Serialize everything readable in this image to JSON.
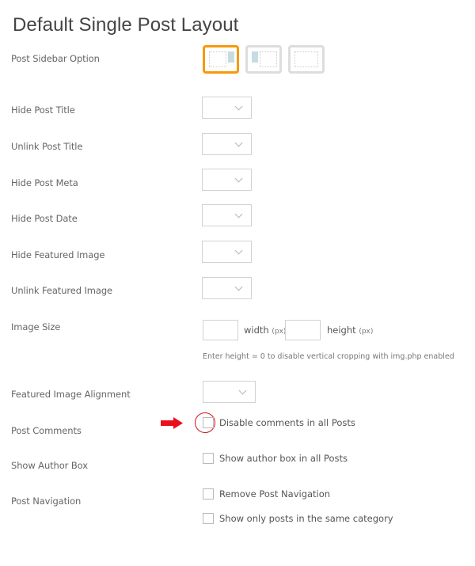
{
  "page": {
    "title": "Default Single Post Layout"
  },
  "sidebar_option": {
    "label": "Post Sidebar Option",
    "options": [
      {
        "name": "sidebar-right",
        "selected": true
      },
      {
        "name": "sidebar-left",
        "selected": false
      },
      {
        "name": "sidebar-none",
        "selected": false
      }
    ],
    "selected_color": "#f7990a"
  },
  "fields": {
    "hide_post_title": {
      "label": "Hide Post Title",
      "value": ""
    },
    "unlink_post_title": {
      "label": "Unlink Post Title",
      "value": ""
    },
    "hide_post_meta": {
      "label": "Hide Post Meta",
      "value": ""
    },
    "hide_post_date": {
      "label": "Hide Post Date",
      "value": ""
    },
    "hide_featured_image": {
      "label": "Hide Featured Image",
      "value": ""
    },
    "unlink_featured_image": {
      "label": "Unlink Featured Image",
      "value": ""
    },
    "image_size": {
      "label": "Image Size",
      "width_value": "",
      "height_value": "",
      "width_label": "width",
      "height_label": "height",
      "unit": "(px)",
      "hint": "Enter height = 0 to disable vertical cropping with img.php enabled"
    },
    "featured_image_alignment": {
      "label": "Featured Image Alignment",
      "value": ""
    },
    "post_comments": {
      "label": "Post Comments",
      "checkbox_label": "Disable comments in all Posts",
      "checked": false
    },
    "show_author_box": {
      "label": "Show Author Box",
      "checkbox_label": "Show author box in all Posts",
      "checked": false
    },
    "post_navigation": {
      "label": "Post Navigation",
      "remove_label": "Remove Post Navigation",
      "remove_checked": false,
      "same_category_label": "Show only posts in the same category",
      "same_category_checked": false
    }
  },
  "annotation": {
    "color": "#d0121b"
  }
}
